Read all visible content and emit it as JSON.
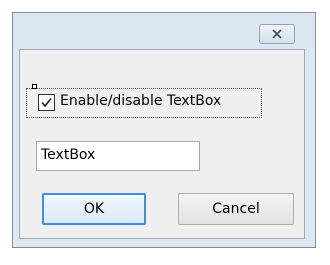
{
  "dialog": {
    "close_icon": "close-icon"
  },
  "checkbox": {
    "label": "Enable/disable TextBox",
    "checked": true
  },
  "textbox": {
    "value": "TextBox"
  },
  "buttons": {
    "ok_label": "OK",
    "cancel_label": "Cancel"
  },
  "colors": {
    "title_bar": "#dae6f2",
    "client_bg": "#f0f0f0",
    "default_button_border": "#3f8ee0"
  }
}
